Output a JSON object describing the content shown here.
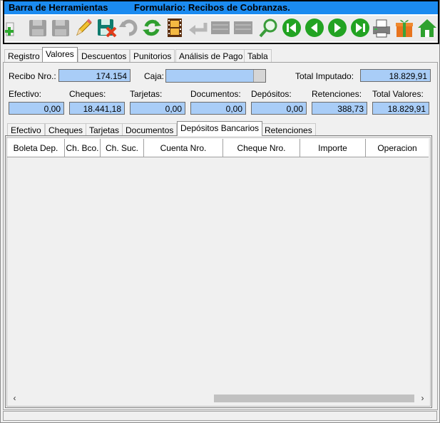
{
  "toolbar": {
    "window_title": "Barra de Herramientas",
    "form_title": "Formulario: Recibos de Cobranzas.",
    "icons": [
      "add-icon",
      "save-disabled-icon",
      "save-disabled-icon",
      "edit-icon",
      "delete-icon",
      "undo-disabled-icon",
      "refresh-icon",
      "film-icon",
      "back-disabled-icon",
      "disabled-icon",
      "disabled-icon",
      "search-icon",
      "first-icon",
      "prev-icon",
      "next-icon",
      "last-icon",
      "print-icon",
      "gift-icon",
      "home-icon"
    ]
  },
  "main_tabs": [
    "Registro",
    "Valores",
    "Descuentos",
    "Punitorios",
    "Análisis de Pago",
    "Tabla"
  ],
  "active_main_tab": "Valores",
  "header": {
    "recibo_label": "Recibo Nro.:",
    "recibo_value": "174.154",
    "caja_label": "Caja:",
    "caja_value": "",
    "total_imputado_label": "Total Imputado:",
    "total_imputado_value": "18.829,91"
  },
  "totals": [
    {
      "label": "Efectivo:",
      "value": "0,00"
    },
    {
      "label": "Cheques:",
      "value": "18.441,18"
    },
    {
      "label": "Tarjetas:",
      "value": "0,00"
    },
    {
      "label": "Documentos:",
      "value": "0,00"
    },
    {
      "label": "Depósitos:",
      "value": "0,00"
    },
    {
      "label": "Retenciones:",
      "value": "388,73"
    },
    {
      "label": "Total Valores:",
      "value": "18.829,91"
    }
  ],
  "sub_tabs": [
    "Efectivo",
    "Cheques",
    "Tarjetas",
    "Documentos",
    "Depósitos Bancarios",
    "Retenciones"
  ],
  "active_sub_tab": "Depósitos Bancarios",
  "table": {
    "columns": [
      "Boleta Dep.",
      "Ch. Bco.",
      "Ch. Suc.",
      "Cuenta Nro.",
      "Cheque Nro.",
      "Importe",
      "Operacion"
    ],
    "rows": []
  },
  "colors": {
    "title_bar": "#1b8bf0",
    "value_field": "#a9cdf7"
  }
}
